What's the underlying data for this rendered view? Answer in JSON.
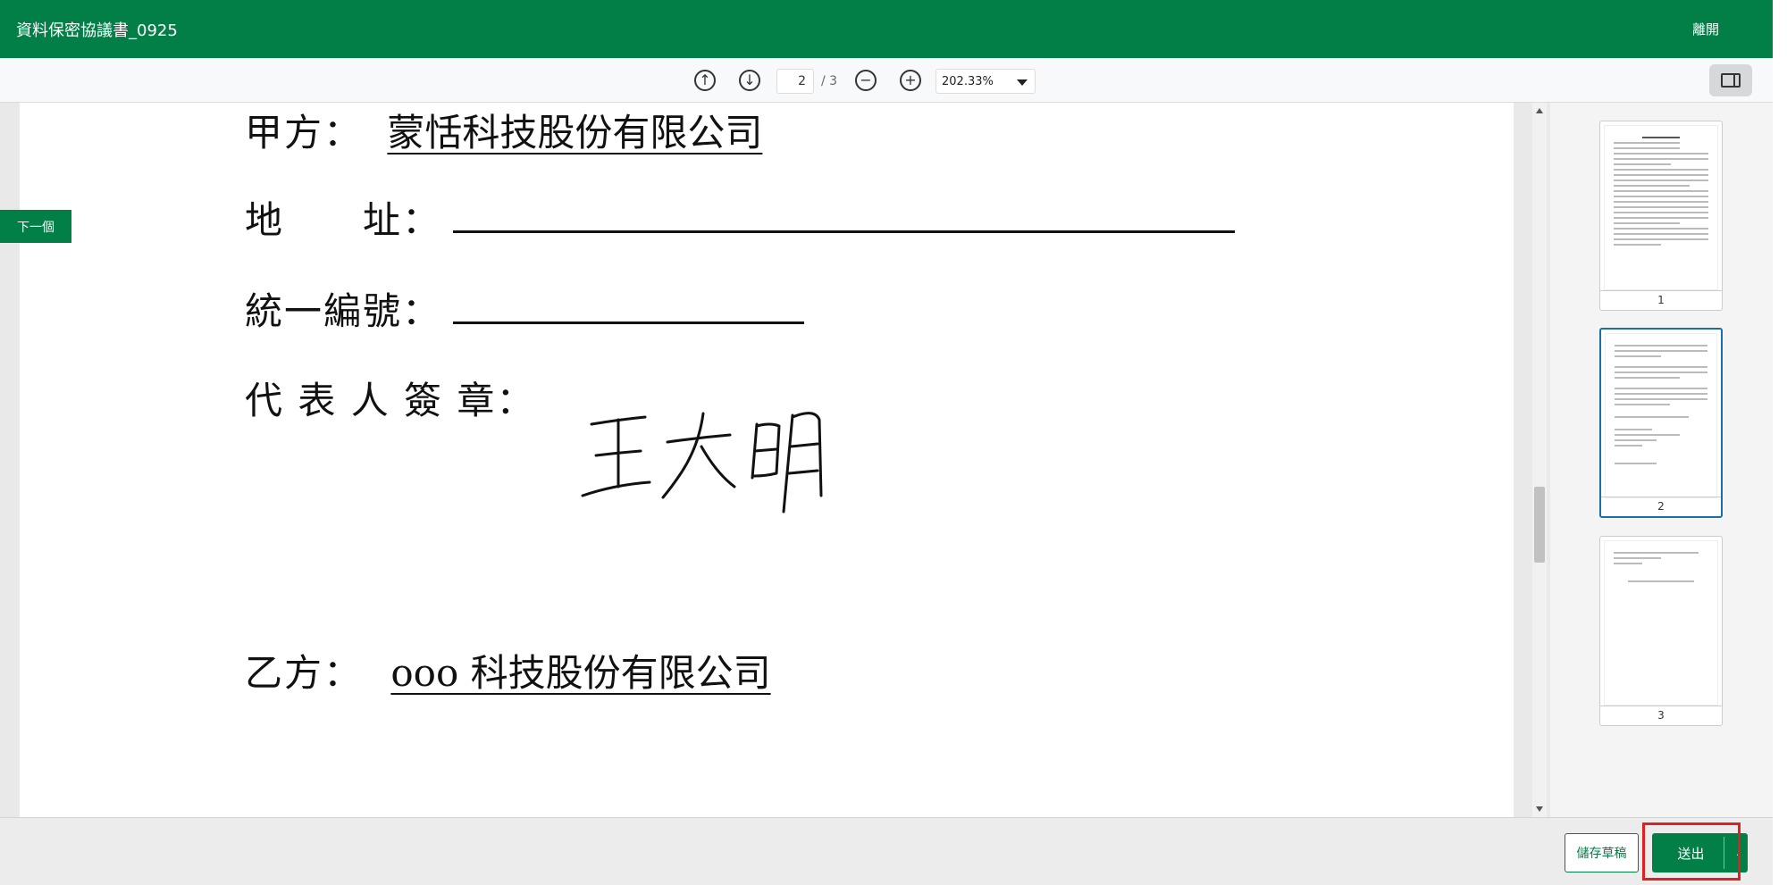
{
  "header": {
    "title": "資料保密協議書_0925",
    "leave_label": "離開",
    "bg_color": "#027f47"
  },
  "toolbar": {
    "prev_icon": "arrow-up-circle-icon",
    "next_icon": "arrow-down-circle-icon",
    "current_page": "2",
    "total_pages": "/ 3",
    "zoom_out_icon": "minus-circle-icon",
    "zoom_in_icon": "plus-circle-icon",
    "zoom_level": "202.33%",
    "sidebar_icon": "sidebar-toggle-icon"
  },
  "side_nav": {
    "next_field_label": "下一個"
  },
  "document": {
    "party_a_label": "甲方：",
    "party_a_name": "蒙恬科技股份有限公司",
    "address_label": "地　　址：",
    "tax_id_label": "統一編號：",
    "representative_label": "代 表 人 簽 章：",
    "signature_text": "王大明",
    "party_b_label": "乙方：",
    "party_b_name": "ooo 科技股份有限公司"
  },
  "thumbnails": [
    {
      "number": "1",
      "active": false
    },
    {
      "number": "2",
      "active": true
    },
    {
      "number": "3",
      "active": false
    }
  ],
  "footer": {
    "save_draft_label": "儲存草稿",
    "send_label": "送出"
  },
  "colors": {
    "accent": "#027f47",
    "highlight": "#e02020",
    "active_thumb": "#1a6fa8"
  }
}
